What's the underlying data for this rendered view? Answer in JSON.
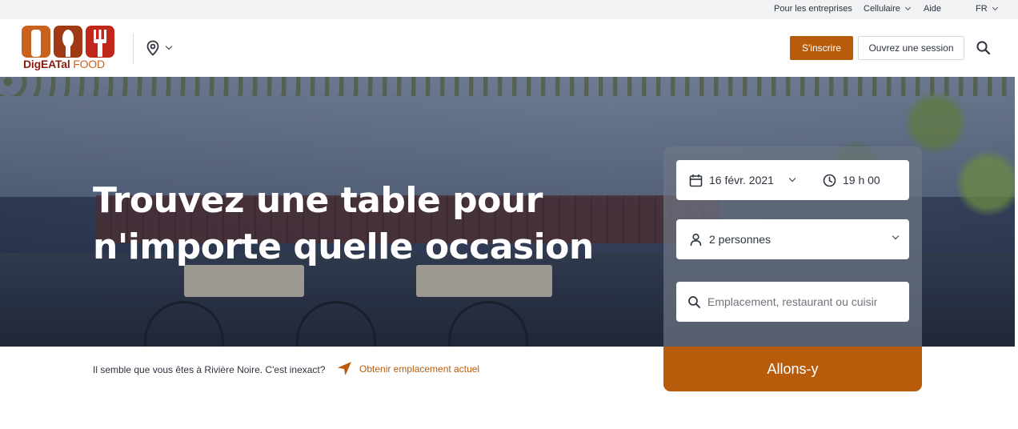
{
  "utility_bar": {
    "business": "Pour les entreprises",
    "mobile": "Cellulaire",
    "help": "Aide",
    "language": "FR"
  },
  "header": {
    "logo_name": "DigEATal",
    "logo_suffix": "FOOD",
    "signup_label": "S'inscrire",
    "login_label": "Ouvrez une session"
  },
  "hero": {
    "title_line1": "Trouvez une table pour",
    "title_line2": "n'importe quelle occasion"
  },
  "booking": {
    "date": "16 févr. 2021",
    "time": "19 h 00",
    "party_size": "2 personnes",
    "search_placeholder": "Emplacement, restaurant ou cuisine",
    "submit_label": "Allons-y"
  },
  "location_notice": {
    "message": "Il semble que vous êtes à Rivière Noire. C'est inexact?",
    "action_label": "Obtenir emplacement actuel"
  },
  "colors": {
    "accent": "#b85c0c",
    "logo_red": "#8b1c12",
    "logo_orange": "#c8621c",
    "text": "#2d333f"
  },
  "icons": [
    "location-pin-icon",
    "chevron-down-icon",
    "search-icon",
    "calendar-icon",
    "clock-icon",
    "person-icon",
    "navigation-arrow-icon"
  ]
}
